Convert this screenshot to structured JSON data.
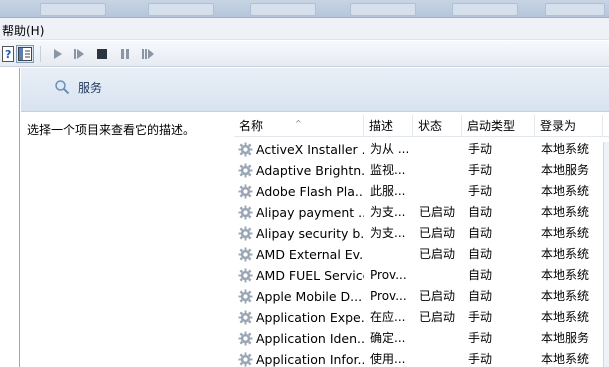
{
  "menubar": {
    "help_label": "帮助(H)"
  },
  "toolbar": {
    "buttons": [
      "help-icon",
      "show-hide-console-tree-icon",
      "start-icon",
      "start-alt-icon",
      "stop-icon",
      "pause-icon",
      "restart-icon"
    ]
  },
  "services_header": {
    "title": "服务",
    "icon": "magnifier-icon"
  },
  "description_pane": {
    "text": "选择一个项目来查看它的描述。"
  },
  "columns": {
    "name": "名称",
    "description": "描述",
    "status": "状态",
    "startup_type": "启动类型",
    "logon_as": "登录为"
  },
  "rows": [
    {
      "name": "ActiveX Installer ...",
      "description": "为从 ...",
      "status": "",
      "startup": "手动",
      "logon": "本地系统"
    },
    {
      "name": "Adaptive Brightn...",
      "description": "监视...",
      "status": "",
      "startup": "手动",
      "logon": "本地服务"
    },
    {
      "name": "Adobe Flash Pla...",
      "description": "此服...",
      "status": "",
      "startup": "手动",
      "logon": "本地系统"
    },
    {
      "name": "Alipay payment ...",
      "description": "为支...",
      "status": "已启动",
      "startup": "自动",
      "logon": "本地系统"
    },
    {
      "name": "Alipay security b...",
      "description": "为支...",
      "status": "已启动",
      "startup": "自动",
      "logon": "本地系统"
    },
    {
      "name": "AMD External Ev...",
      "description": "",
      "status": "已启动",
      "startup": "自动",
      "logon": "本地系统"
    },
    {
      "name": "AMD FUEL Service",
      "description": "Prov...",
      "status": "",
      "startup": "自动",
      "logon": "本地系统"
    },
    {
      "name": "Apple Mobile D...",
      "description": "Prov...",
      "status": "已启动",
      "startup": "自动",
      "logon": "本地系统"
    },
    {
      "name": "Application Expe...",
      "description": "在应...",
      "status": "已启动",
      "startup": "手动",
      "logon": "本地系统"
    },
    {
      "name": "Application Iden...",
      "description": "确定...",
      "status": "",
      "startup": "手动",
      "logon": "本地服务"
    },
    {
      "name": "Application Infor...",
      "description": "使用...",
      "status": "",
      "startup": "手动",
      "logon": "本地系统"
    }
  ]
}
